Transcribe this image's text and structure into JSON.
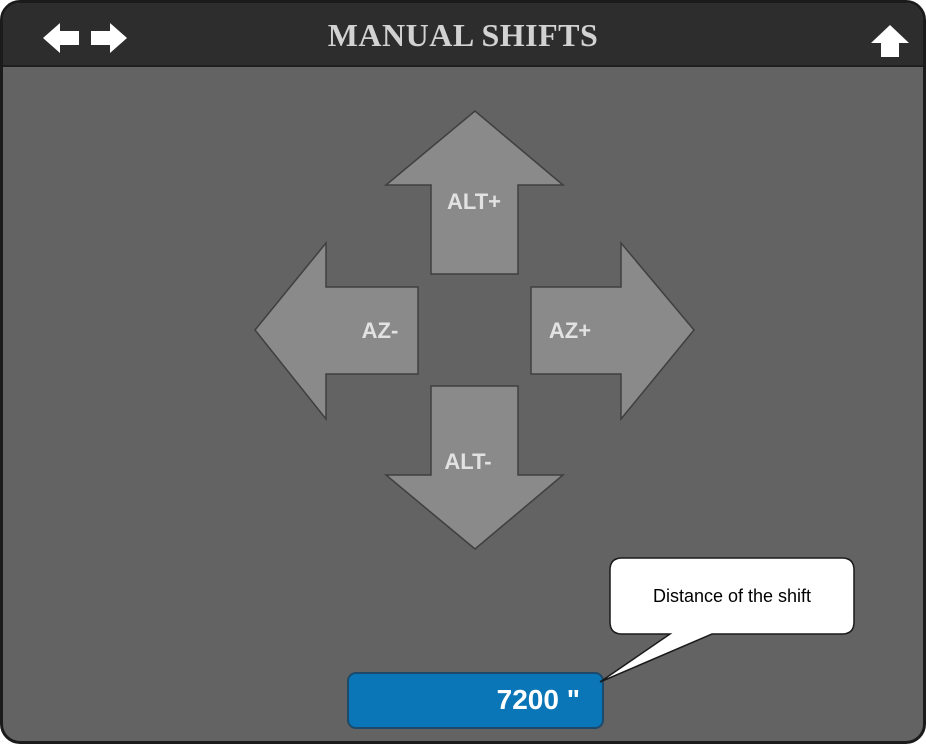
{
  "header": {
    "title": "MANUAL SHIFTS",
    "left_icon": "left-right-arrows-icon",
    "right_icon": "up-arrow-icon"
  },
  "controls": {
    "alt_plus": "ALT+",
    "alt_minus": "ALT-",
    "az_minus": "AZ-",
    "az_plus": "AZ+"
  },
  "shift_distance": {
    "value": "7200 \""
  },
  "callout": {
    "text": "Distance of the shift"
  },
  "colors": {
    "panel_bg": "#636363",
    "header_bg": "#2d2d2d",
    "arrow_fill": "#8a8a8a",
    "value_bg": "#0a76b7"
  }
}
